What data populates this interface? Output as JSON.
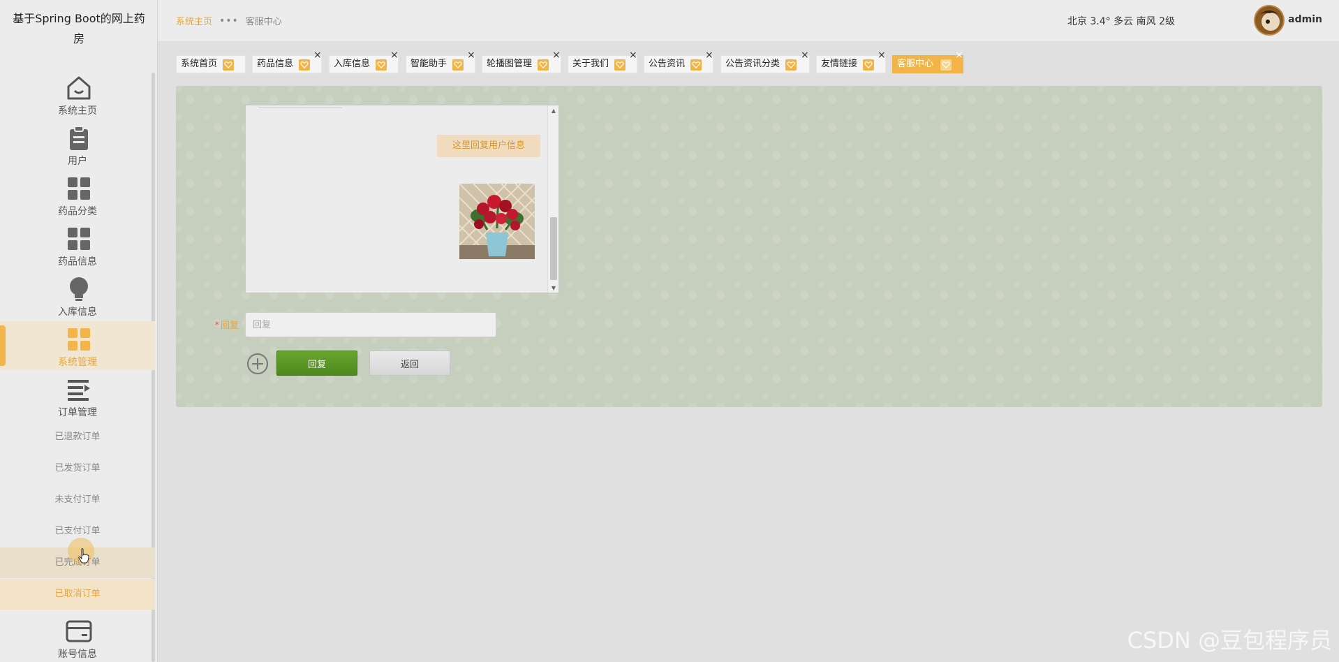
{
  "app": {
    "title": "基于Spring Boot的网上药房"
  },
  "sidebar": {
    "items": [
      {
        "label": "系统主页",
        "icon": "home-icon"
      },
      {
        "label": "用户",
        "icon": "clipboard-icon"
      },
      {
        "label": "药品分类",
        "icon": "grid-icon"
      },
      {
        "label": "药品信息",
        "icon": "grid-icon"
      },
      {
        "label": "入库信息",
        "icon": "lightbulb-icon"
      },
      {
        "label": "系统管理",
        "icon": "grid-icon",
        "active": true
      },
      {
        "label": "订单管理",
        "icon": "list-icon"
      }
    ],
    "order_sub": [
      "已退款订单",
      "已发货订单",
      "未支付订单",
      "已支付订单",
      "已完成订单",
      "已取消订单"
    ],
    "account": {
      "label": "账号信息",
      "icon": "card-icon"
    }
  },
  "header": {
    "breadcrumb_home": "系统主页",
    "breadcrumb_sep": "•••",
    "breadcrumb_current": "客服中心",
    "weather": "北京  3.4°  多云  南风  2级",
    "username": "admin"
  },
  "tabs": [
    {
      "label": "系统首页",
      "closable": false
    },
    {
      "label": "药品信息",
      "closable": true
    },
    {
      "label": "入库信息",
      "closable": true
    },
    {
      "label": "智能助手",
      "closable": true
    },
    {
      "label": "轮播图管理",
      "closable": true
    },
    {
      "label": "关于我们",
      "closable": true
    },
    {
      "label": "公告资讯",
      "closable": true
    },
    {
      "label": "公告资讯分类",
      "closable": true
    },
    {
      "label": "友情链接",
      "closable": true
    },
    {
      "label": "客服中心",
      "closable": true,
      "active": true
    }
  ],
  "chat": {
    "reply_bubble": "这里回复用户信息"
  },
  "form": {
    "required_mark": "*",
    "reply_label": "回复",
    "reply_placeholder": "回复",
    "submit_label": "回复",
    "back_label": "返回"
  },
  "watermark": "CSDN @豆包程序员",
  "colors": {
    "accent": "#e9a638",
    "tab_active": "#f2b449",
    "submit_green": "#5b9a26",
    "panel_bg": "#c6cebd"
  }
}
